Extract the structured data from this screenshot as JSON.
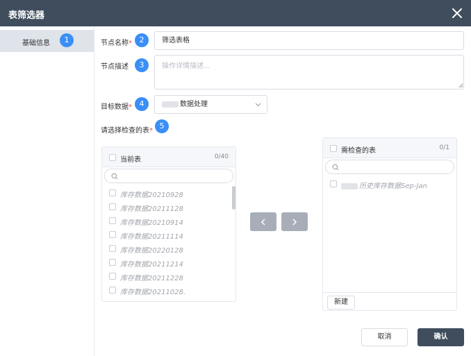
{
  "dialog": {
    "title": "表筛选器"
  },
  "sidebar": {
    "items": [
      {
        "label": "基础信息",
        "badge": "1"
      }
    ]
  },
  "form": {
    "node_name": {
      "label": "节点名称",
      "required": "*",
      "badge": "2",
      "value": "筛选表格"
    },
    "node_desc": {
      "label": "节点描述",
      "badge": "3",
      "placeholder": "操作详情描述..."
    },
    "target_data": {
      "label": "目标数据",
      "required": "*",
      "badge": "4",
      "value": "数据处理"
    },
    "select_tables": {
      "label": "请选择检查的表",
      "required": "*",
      "badge": "5"
    }
  },
  "transfer": {
    "left": {
      "title": "当前表",
      "count": "0/40",
      "items": [
        "库存数据20210928",
        "库存数据20211128",
        "库存数据20210914",
        "库存数据20211114",
        "库存数据20220128",
        "库存数据20211214",
        "库存数据20211228",
        "库存数据20211028."
      ]
    },
    "right": {
      "title": "需检查的表",
      "count": "0/1",
      "items": [
        "历史库存数据Sep-Jan"
      ],
      "new_button": "新建"
    }
  },
  "footer": {
    "cancel": "取消",
    "confirm": "确认"
  },
  "colors": {
    "header": "#3f4d5d",
    "badge": "#3a8ff7",
    "confirm": "#3f4d5d",
    "arrow": "#a7aeb8"
  },
  "icons": {
    "close": "close-icon",
    "search": "search-icon",
    "dropdown": "chevron-down-icon",
    "left": "chevron-left-icon",
    "right": "chevron-right-icon"
  }
}
